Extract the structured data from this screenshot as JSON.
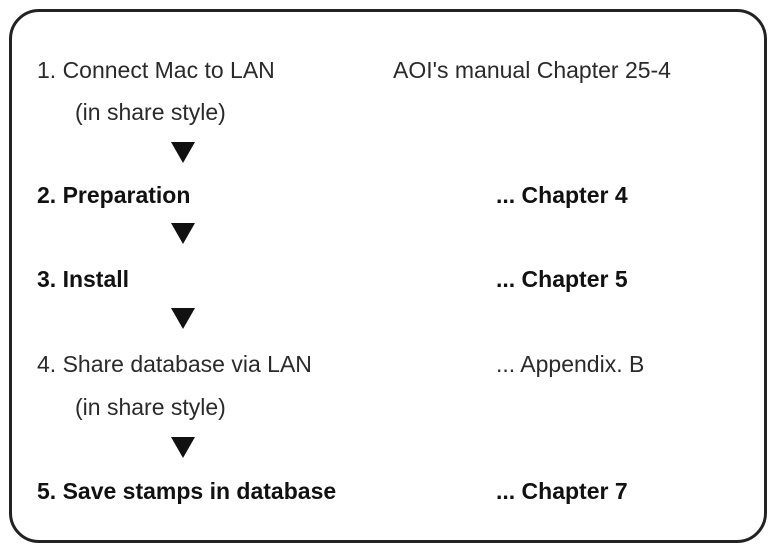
{
  "steps": [
    {
      "label": "1. Connect Mac to LAN",
      "sublabel": "(in share style)",
      "reference": "AOI's manual Chapter 25-4"
    },
    {
      "label": "2. Preparation",
      "reference": "...  Chapter 4"
    },
    {
      "label": "3. Install",
      "reference": "...  Chapter 5"
    },
    {
      "label": "4. Share database via LAN",
      "sublabel": "(in share style)",
      "reference": "...  Appendix. B"
    },
    {
      "label": "5. Save stamps in database",
      "reference": "...  Chapter 7"
    }
  ],
  "arrow_icon": "down-triangle-icon"
}
